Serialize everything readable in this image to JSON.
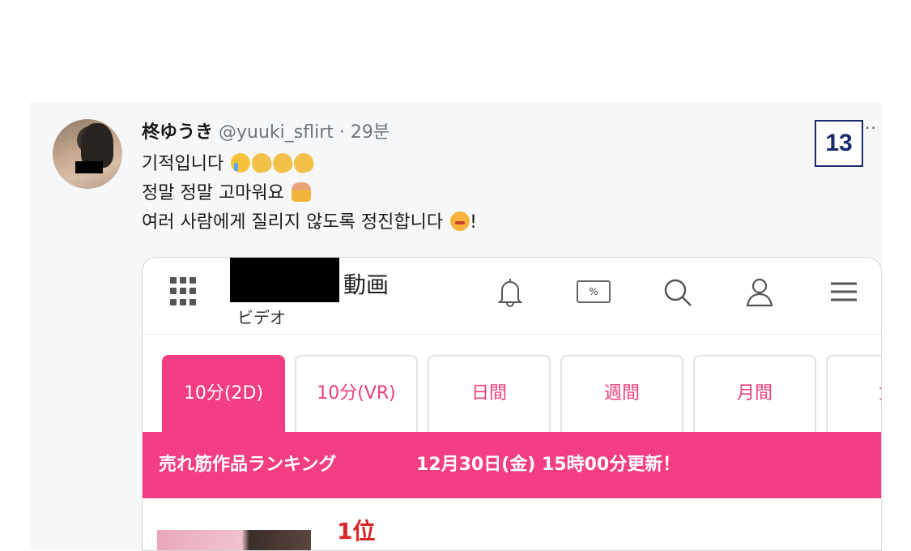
{
  "tweet": {
    "display_name": "柊ゆうき",
    "handle": "@yuuki_sflirt",
    "separator": "·",
    "time": "29분",
    "lines": [
      "기적입니다",
      "정말 정말 고마워요",
      "여러 사람에게 질리지 않도록 정진합니다",
      "!"
    ],
    "emojis": [
      "crying-face",
      "clapping-hands",
      "clapping-hands",
      "clapping-hands",
      "person-bowing",
      "face-with-steam"
    ]
  },
  "badge": {
    "number": "13"
  },
  "more_label": "··",
  "site": {
    "brand_text": "動画",
    "brand_sub": "ビデオ",
    "coupon_label": "%",
    "tabs": [
      {
        "label": "10分(2D)",
        "active": true
      },
      {
        "label": "10分(VR)",
        "active": false
      },
      {
        "label": "日間",
        "active": false
      },
      {
        "label": "週間",
        "active": false
      },
      {
        "label": "月間",
        "active": false
      },
      {
        "label": "女",
        "active": false
      }
    ],
    "banner_title": "売れ筋作品ランキング",
    "banner_update": "12月30日(金) 15時00分更新！",
    "rank_label": "1位"
  },
  "colors": {
    "accent": "#f53d83",
    "rank_red": "#d8262a",
    "badge_border": "#1a2b6b"
  }
}
